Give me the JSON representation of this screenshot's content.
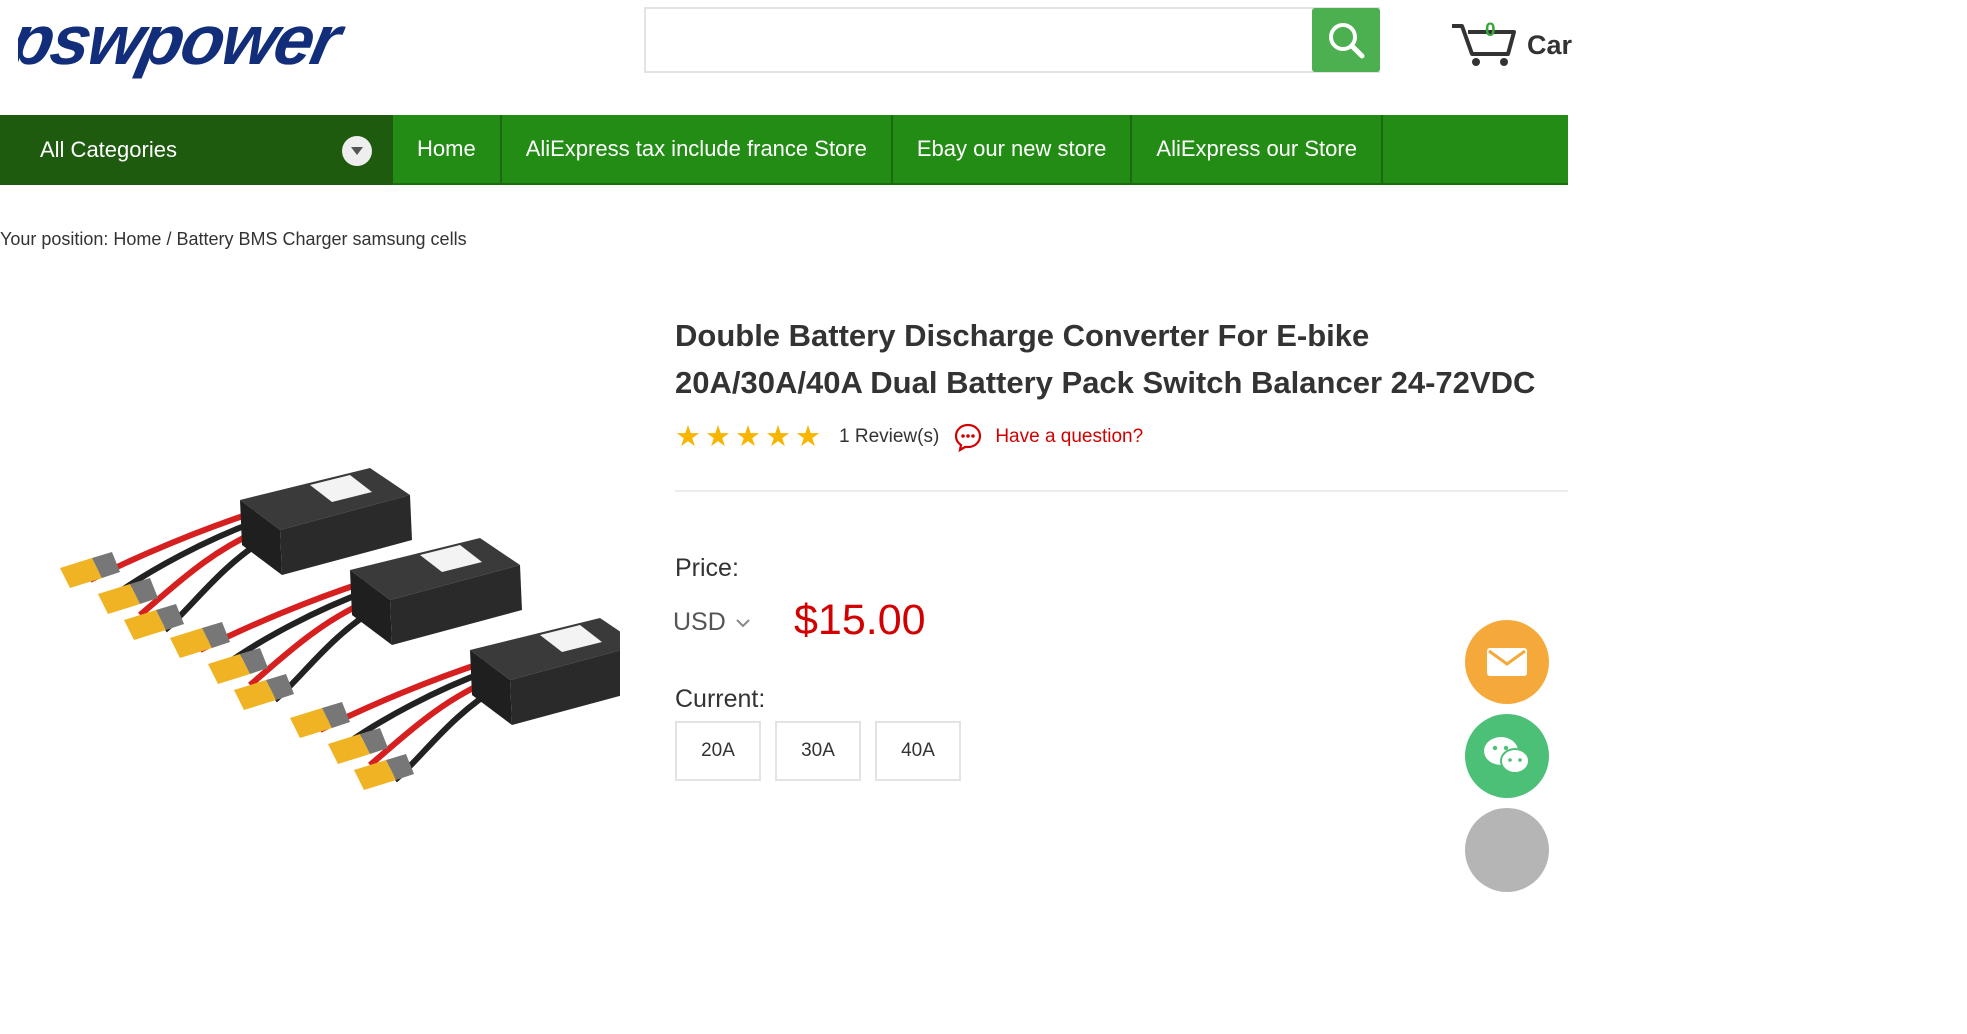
{
  "header": {
    "logo_text": "pswpower",
    "search": {
      "placeholder": "",
      "value": ""
    },
    "cart": {
      "count": "0",
      "label": "Car"
    }
  },
  "nav": {
    "all_categories": "All Categories",
    "items": [
      "Home",
      "AliExpress tax include france Store",
      "Ebay our new store",
      "AliExpress our Store"
    ]
  },
  "breadcrumb": {
    "prefix": "Your position: ",
    "home": "Home",
    "separator": " / ",
    "current": "Battery BMS Charger samsung cells"
  },
  "product": {
    "title_line1": "Double Battery Discharge Converter For E-bike",
    "title_line2": "20A/30A/40A Dual Battery Pack Switch Balancer 24-72VDC",
    "rating_stars": 5,
    "reviews": "1 Review(s)",
    "question": "Have a question?",
    "price_label": "Price:",
    "currency": "USD",
    "price": "$15.00",
    "current_label": "Current:",
    "options": [
      "20A",
      "30A",
      "40A"
    ]
  },
  "colors": {
    "nav_green": "#238c15",
    "all_categories_bg": "#1e5b0f",
    "search_button": "#4caf50",
    "price_red": "#d20000",
    "star_gold": "#f7b500",
    "mail_button": "#f5a93b",
    "wechat_button": "#4cc077"
  }
}
